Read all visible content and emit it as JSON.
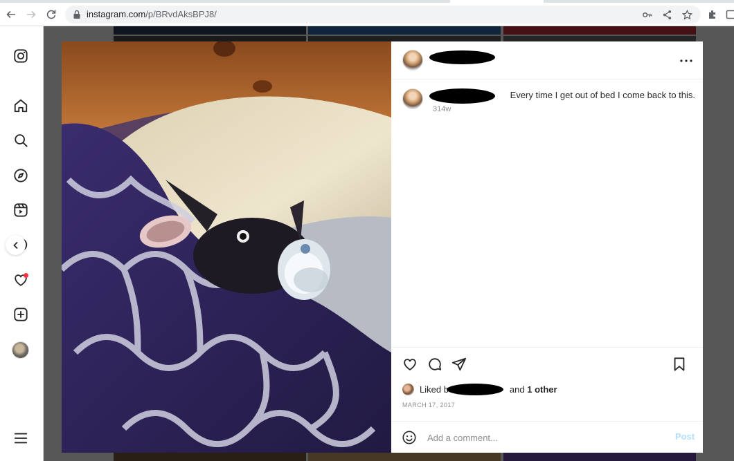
{
  "browser": {
    "url_host": "instagram.com",
    "url_path": "/p/BRvdAksBPJ8/"
  },
  "sidenav": {
    "items": [
      {
        "icon": "instagram-logo-icon"
      },
      {
        "icon": "home-icon"
      },
      {
        "icon": "search-icon"
      },
      {
        "icon": "explore-icon"
      },
      {
        "icon": "reels-icon"
      },
      {
        "icon": "messages-icon"
      },
      {
        "icon": "heart-icon"
      },
      {
        "icon": "create-icon"
      },
      {
        "icon": "profile-avatar"
      },
      {
        "icon": "menu-icon"
      }
    ]
  },
  "post": {
    "username": "",
    "caption": "Every time I get out of bed I come back to this.",
    "caption_age": "314w",
    "liked_prefix": "Liked b",
    "liked_mid": "and",
    "liked_other": "1 other",
    "date": "MARCH 17, 2017",
    "comment_placeholder": "Add a comment...",
    "post_label": "Post"
  },
  "colors": {
    "accent_disabled": "#b2dffc",
    "notification": "#ff3040",
    "overlay": "rgba(0,0,0,0.65)"
  }
}
